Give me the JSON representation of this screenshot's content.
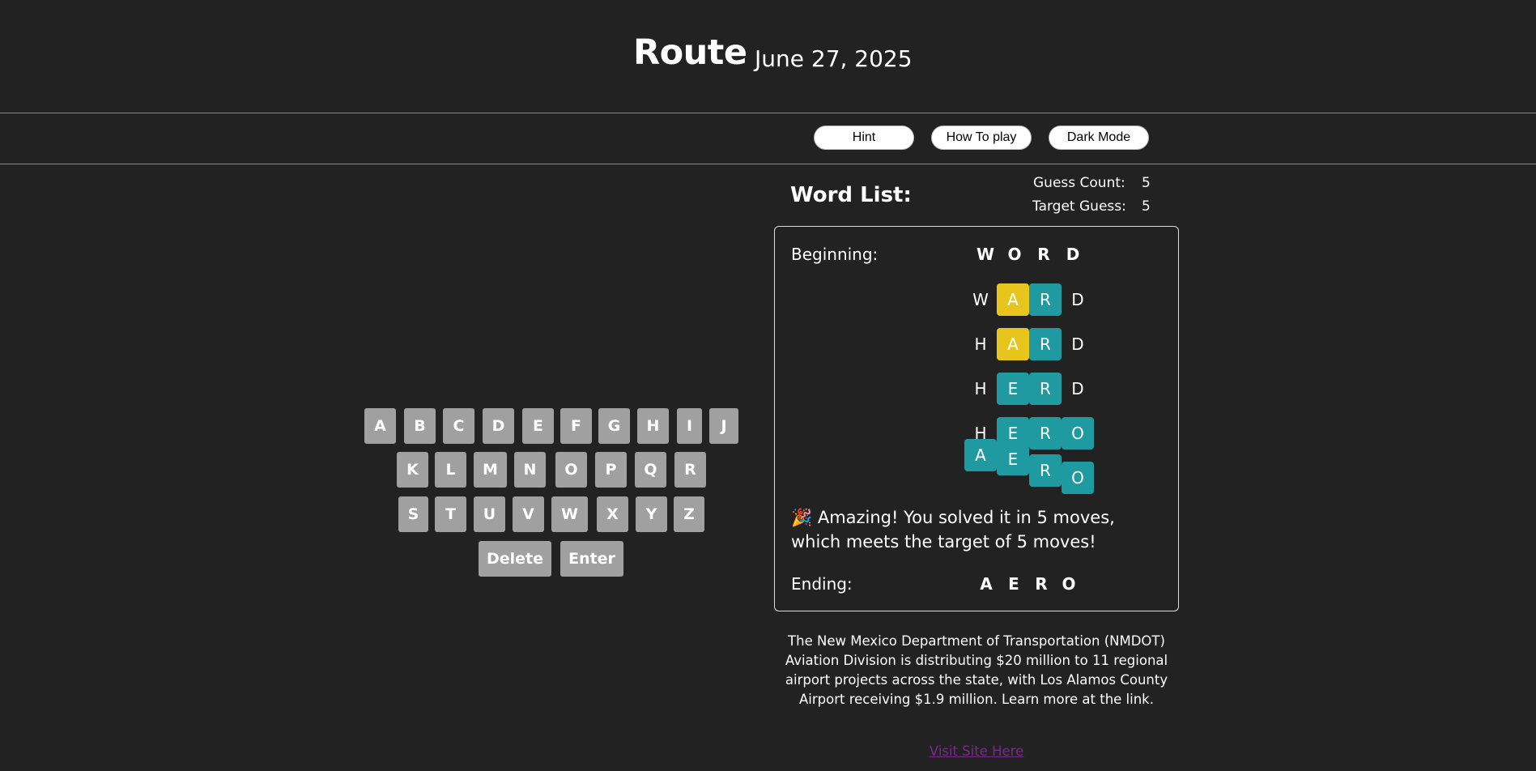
{
  "header": {
    "title": "Route",
    "date": "June 27, 2025"
  },
  "toolbar": {
    "hint": "Hint",
    "how_to": "How To play",
    "dark_mode": "Dark Mode"
  },
  "keyboard": {
    "row1": [
      "A",
      "B",
      "C",
      "D",
      "E",
      "F",
      "G",
      "H",
      "I",
      "J"
    ],
    "row2": [
      "K",
      "L",
      "M",
      "N",
      "O",
      "P",
      "Q",
      "R"
    ],
    "row3": [
      "S",
      "T",
      "U",
      "V",
      "W",
      "X",
      "Y",
      "Z"
    ],
    "delete": "Delete",
    "enter": "Enter"
  },
  "word_list": {
    "title": "Word List:",
    "guess_count_label": "Guess Count:",
    "guess_count": "5",
    "target_label": "Target Guess:",
    "target": "5",
    "beginning_label": "Beginning:",
    "beginning_word": [
      "W",
      "O",
      "R",
      "D"
    ],
    "guesses": [
      [
        "W",
        "A",
        "R",
        "D"
      ],
      [
        "H",
        "A",
        "R",
        "D"
      ],
      [
        "H",
        "E",
        "R",
        "D"
      ],
      [
        "H",
        "E",
        "R",
        "O"
      ],
      [
        "A",
        "E",
        "R",
        "O"
      ]
    ],
    "message": "🎉 Amazing! You solved it in 5 moves, which meets the target of 5 moves!",
    "ending_label": "Ending:",
    "ending_word": [
      "A",
      "E",
      "R",
      "O"
    ]
  },
  "info_text": "The New Mexico Department of Transportation (NMDOT) Aviation Division is distributing $20 million to 11 regional airport projects across the state, with Los Alamos County Airport receiving $1.9 million. Learn more at the link.",
  "visit_link": "Visit Site Here",
  "colors": {
    "yellow": "#e8c51d",
    "teal": "#1e9aa0",
    "key": "#a0a0a0",
    "background": "#222222"
  }
}
